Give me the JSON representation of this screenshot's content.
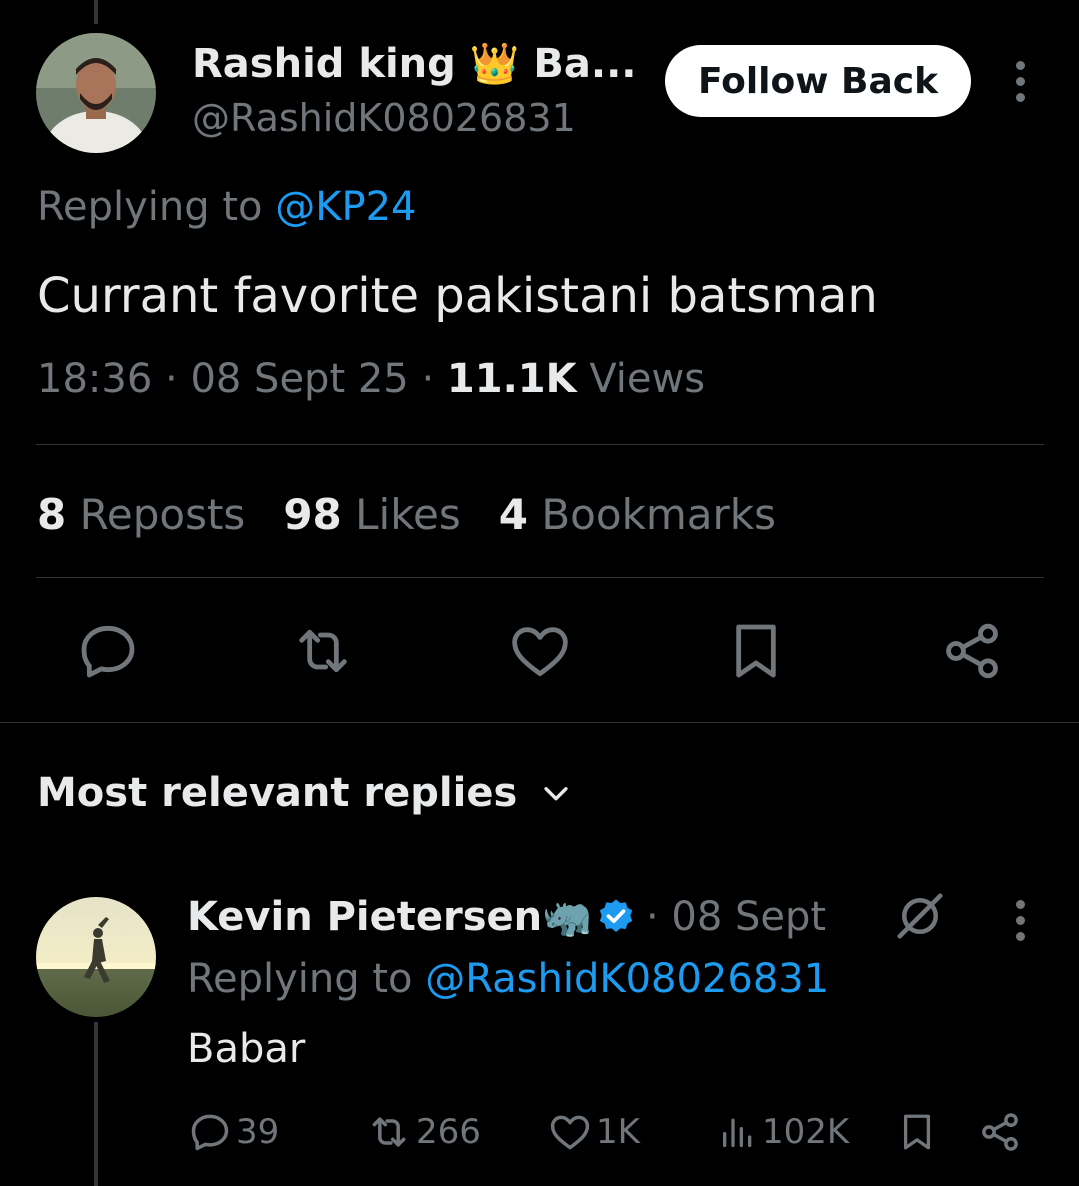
{
  "tweet": {
    "author_name": "Rashid king 👑 Ba...",
    "author_handle": "@RashidK08026831",
    "follow_label": "Follow Back",
    "replying_prefix": "Replying to",
    "replying_mention": "@KP24",
    "text": "Currant favorite pakistani batsman",
    "time": "18:36",
    "date": "08 Sept 25",
    "views_count": "11.1K",
    "views_label": "Views",
    "reposts_count": "8",
    "reposts_label": "Reposts",
    "likes_count": "98",
    "likes_label": "Likes",
    "bookmarks_count": "4",
    "bookmarks_label": "Bookmarks"
  },
  "replies_section": {
    "sort_label": "Most relevant replies"
  },
  "reply": {
    "author_name": "Kevin Pietersen🦏",
    "date": "08 Sept",
    "replying_prefix": "Replying to",
    "replying_mention": "@RashidK08026831",
    "text": "Babar",
    "replies_count": "39",
    "reposts_count": "266",
    "likes_count": "1K",
    "views_count": "102K"
  },
  "colors": {
    "background": "#000000",
    "text_primary": "#e7e9ea",
    "text_secondary": "#71767b",
    "accent_blue": "#1d9bf0",
    "divider": "#2f3336"
  },
  "icons": [
    "more-icon",
    "reply-icon",
    "repost-icon",
    "like-icon",
    "bookmark-icon",
    "share-icon",
    "chevron-down-icon",
    "verified-badge-icon",
    "grok-icon",
    "views-icon"
  ]
}
